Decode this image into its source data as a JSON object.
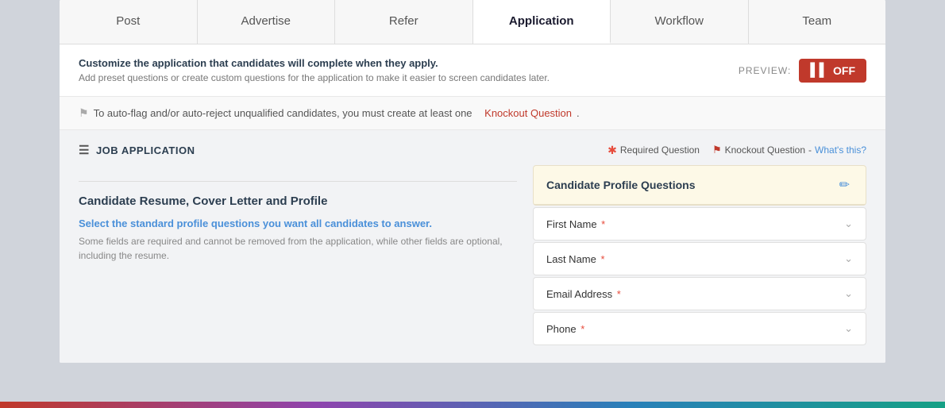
{
  "tabs": [
    {
      "id": "post",
      "label": "Post",
      "active": false
    },
    {
      "id": "advertise",
      "label": "Advertise",
      "active": false
    },
    {
      "id": "refer",
      "label": "Refer",
      "active": false
    },
    {
      "id": "application",
      "label": "Application",
      "active": true
    },
    {
      "id": "workflow",
      "label": "Workflow",
      "active": false
    },
    {
      "id": "team",
      "label": "Team",
      "active": false
    }
  ],
  "header": {
    "main_text": "Customize the application that candidates will complete when they apply.",
    "sub_text": "Add preset questions or create custom questions for the application to make it easier to screen candidates later.",
    "preview_label": "PREVIEW:",
    "toggle_label": "OFF"
  },
  "flag_notice": {
    "text": "To auto-flag and/or auto-reject unqualified candidates, you must create at least one",
    "link_text": "Knockout Question",
    "text_end": "."
  },
  "job_application": {
    "title": "JOB APPLICATION",
    "legend": {
      "required_label": "Required Question",
      "knockout_label": "Knockout Question",
      "whats_this": "What's this?"
    },
    "left_section": {
      "title": "Candidate Resume, Cover Letter and Profile",
      "desc_bold": "Select the standard profile questions you want all candidates to answer.",
      "desc": "Some fields are required and cannot be removed from the application, while other fields are optional, including the resume."
    },
    "profile_questions": {
      "card_title": "Candidate Profile Questions",
      "fields": [
        {
          "label": "First Name",
          "required": true
        },
        {
          "label": "Last Name",
          "required": true
        },
        {
          "label": "Email Address",
          "required": true
        },
        {
          "label": "Phone",
          "required": true
        }
      ]
    }
  }
}
